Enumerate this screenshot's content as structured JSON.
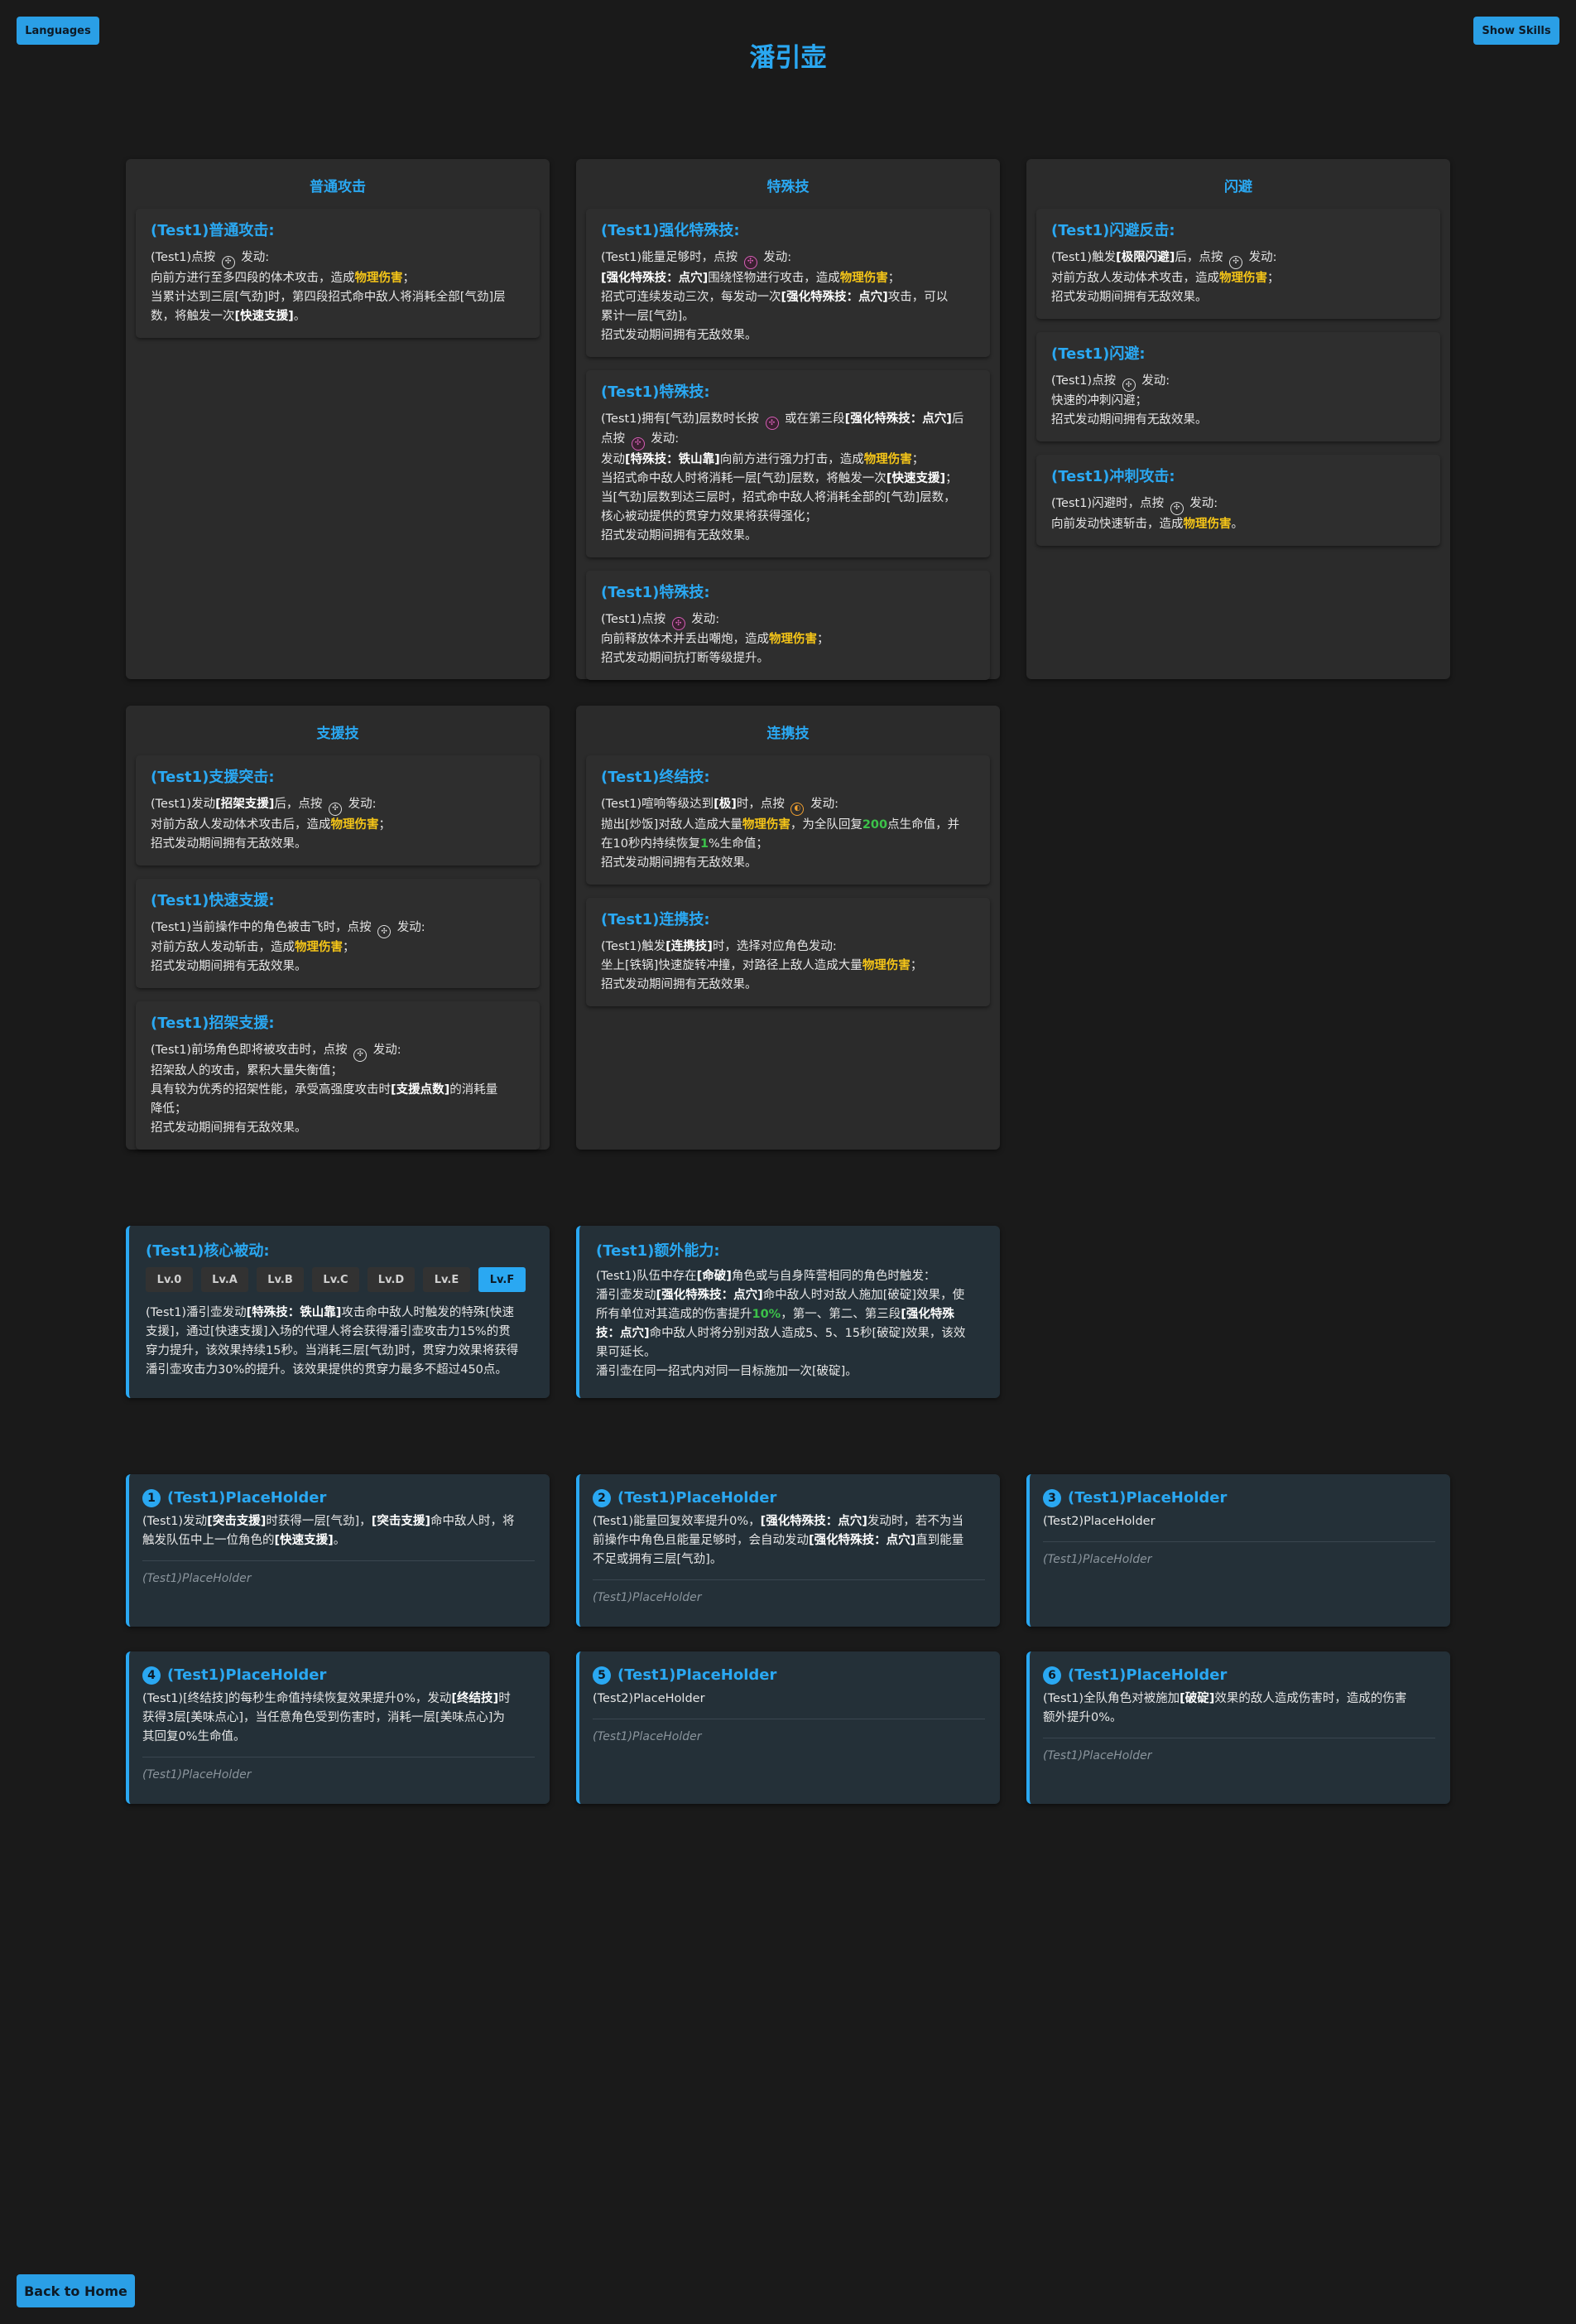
{
  "header": {
    "languages_label": "Languages",
    "show_skills_label": "Show Skills",
    "title": "潘引壶",
    "back_home_label": "Back to Home"
  },
  "panels": {
    "normal": {
      "title": "普通攻击",
      "skills": [
        {
          "name": "(Test1)普通攻击:",
          "lines": [
            "(Test1)点按 {ico:white} 发动:",
            "向前方进行至多四段的体术攻击，造成{hl:物理伤害}；",
            "当累计达到三层[气劲]时，第四段招式命中敌人将消耗全部[气劲]层",
            "数，将触发一次{b:[快速支援]}。"
          ]
        }
      ]
    },
    "special": {
      "title": "特殊技",
      "skills": [
        {
          "name": "(Test1)强化特殊技:",
          "lines": [
            "(Test1)能量足够时，点按 {ico:pink} 发动:",
            "{b:[强化特殊技：点穴]}围绕怪物进行攻击，造成{hl:物理伤害}；",
            "招式可连续发动三次，每发动一次{b:[强化特殊技：点穴]}攻击，可以",
            "累计一层[气劲]。",
            "招式发动期间拥有无敌效果。"
          ]
        },
        {
          "name": "(Test1)特殊技:",
          "lines": [
            "(Test1)拥有[气劲]层数时长按 {ico:pink} 或在第三段{b:[强化特殊技：点穴]}后",
            "点按 {ico:pink} 发动:",
            "发动{b:[特殊技：铁山靠]}向前方进行强力打击，造成{hl:物理伤害}；",
            "当招式命中敌人时将消耗一层[气劲]层数，将触发一次{b:[快速支援]}；",
            "当[气劲]层数到达三层时，招式命中敌人将消耗全部的[气劲]层数，",
            "核心被动提供的贯穿力效果将获得强化；",
            "招式发动期间拥有无敌效果。"
          ]
        },
        {
          "name": "(Test1)特殊技:",
          "lines": [
            "(Test1)点按 {ico:pink} 发动:",
            "向前释放体术并丢出嘲炮，造成{hl:物理伤害}；",
            "招式发动期间抗打断等级提升。"
          ]
        }
      ]
    },
    "dodge": {
      "title": "闪避",
      "skills": [
        {
          "name": "(Test1)闪避反击:",
          "lines": [
            "(Test1)触发{b:[极限闪避]}后，点按 {ico:white} 发动:",
            "对前方敌人发动体术攻击，造成{hl:物理伤害}；",
            "招式发动期间拥有无敌效果。"
          ]
        },
        {
          "name": "(Test1)闪避:",
          "lines": [
            "(Test1)点按 {ico:white} 发动:",
            "快速的冲刺闪避；",
            "招式发动期间拥有无敌效果。"
          ]
        },
        {
          "name": "(Test1)冲刺攻击:",
          "lines": [
            "(Test1)闪避时，点按 {ico:white} 发动:",
            "向前发动快速斩击，造成{hl:物理伤害}。"
          ]
        }
      ]
    },
    "assist": {
      "title": "支援技",
      "skills": [
        {
          "name": "(Test1)支援突击:",
          "lines": [
            "(Test1)发动{b:[招架支援]}后，点按 {ico:white} 发动:",
            "对前方敌人发动体术攻击后，造成{hl:物理伤害}；",
            "招式发动期间拥有无敌效果。"
          ]
        },
        {
          "name": "(Test1)快速支援:",
          "lines": [
            "(Test1)当前操作中的角色被击飞时，点按 {ico:white} 发动:",
            "对前方敌人发动斩击，造成{hl:物理伤害}；",
            "招式发动期间拥有无敌效果。"
          ]
        },
        {
          "name": "(Test1)招架支援:",
          "lines": [
            "(Test1)前场角色即将被攻击时，点按 {ico:white} 发动:",
            "招架敌人的攻击，累积大量失衡值；",
            "具有较为优秀的招架性能，承受高强度攻击时{b:[支援点数]}的消耗量",
            "降低；",
            "招式发动期间拥有无敌效果。"
          ]
        }
      ]
    },
    "chain": {
      "title": "连携技",
      "skills": [
        {
          "name": "(Test1)终结技:",
          "lines": [
            "(Test1)喧响等级达到{b:[极]}时，点按 {ico:orange} 发动:",
            "抛出[炒饭]对敌人造成大量{hl:物理伤害}，为全队回复{gn:200}点生命值，并",
            "在10秒内持续恢复{gn:1}%生命值；",
            "招式发动期间拥有无敌效果。"
          ]
        },
        {
          "name": "(Test1)连携技:",
          "lines": [
            "(Test1)触发{b:[连携技]}时，选择对应角色发动:",
            "坐上[铁锅]快速旋转冲撞，对路径上敌人造成大量{hl:物理伤害}；",
            "招式发动期间拥有无敌效果。"
          ]
        }
      ]
    }
  },
  "core_passive": {
    "title": "(Test1)核心被动:",
    "levels": [
      "Lv.0",
      "Lv.A",
      "Lv.B",
      "Lv.C",
      "Lv.D",
      "Lv.E",
      "Lv.F"
    ],
    "selected_level": "Lv.F",
    "lines": [
      "(Test1)潘引壶发动{b:[特殊技：铁山靠]}攻击命中敌人时触发的特殊[快速",
      "支援]，通过[快速支援]入场的代理人将会获得潘引壶攻击力15%的贯",
      "穿力提升，该效果持续15秒。当消耗三层[气劲]时，贯穿力效果将获得",
      "潘引壶攻击力30%的提升。该效果提供的贯穿力最多不超过450点。"
    ]
  },
  "extra_ability": {
    "title": "(Test1)额外能力:",
    "lines": [
      "(Test1)队伍中存在{b:[命破]}角色或与自身阵营相同的角色时触发：",
      "潘引壶发动{b:[强化特殊技：点穴]}命中敌人时对敌人施加[破碇]效果，使",
      "所有单位对其造成的伤害提升{gn:10%}，第一、第二、第三段{b:[强化特殊}",
      "{b:技：点穴]}命中敌人时将分别对敌人造成5、5、15秒[破碇]效果，该效",
      "果可延长。",
      "潘引壶在同一招式内对同一目标施加一次[破碇]。"
    ]
  },
  "talents": [
    {
      "num": "1",
      "title": "(Test1)PlaceHolder",
      "lines": [
        "(Test1)发动{b:[突击支援]}时获得一层[气劲]，{b:[突击支援]}命中敌人时，将",
        "触发队伍中上一位角色的{b:[快速支援]}。"
      ],
      "note": "(Test1)PlaceHolder"
    },
    {
      "num": "2",
      "title": "(Test1)PlaceHolder",
      "lines": [
        "(Test1)能量回复效率提升0%，{b:[强化特殊技：点穴]}发动时，若不为当",
        "前操作中角色且能量足够时，会自动发动{b:[强化特殊技：点穴]}直到能量",
        "不足或拥有三层[气劲]。"
      ],
      "note": "(Test1)PlaceHolder"
    },
    {
      "num": "3",
      "title": "(Test1)PlaceHolder",
      "lines": [
        "(Test2)PlaceHolder"
      ],
      "note": "(Test1)PlaceHolder"
    },
    {
      "num": "4",
      "title": "(Test1)PlaceHolder",
      "lines": [
        "(Test1)[终结技]的每秒生命值持续恢复效果提升0%，发动{b:[终结技]}时",
        "获得3层[美味点心]，当任意角色受到伤害时，消耗一层[美味点心]为",
        "其回复0%生命值。"
      ],
      "note": "(Test1)PlaceHolder"
    },
    {
      "num": "5",
      "title": "(Test1)PlaceHolder",
      "lines": [
        "(Test2)PlaceHolder"
      ],
      "note": "(Test1)PlaceHolder"
    },
    {
      "num": "6",
      "title": "(Test1)PlaceHolder",
      "lines": [
        "(Test1)全队角色对被施加{b:[破碇]}效果的敌人造成伤害时，造成的伤害",
        "额外提升0%。"
      ],
      "note": "(Test1)PlaceHolder"
    }
  ],
  "colors": {
    "accent": "#2aa8f2",
    "highlight": "#f5c518",
    "green": "#3cc24a",
    "background": "#1a1a1a"
  }
}
